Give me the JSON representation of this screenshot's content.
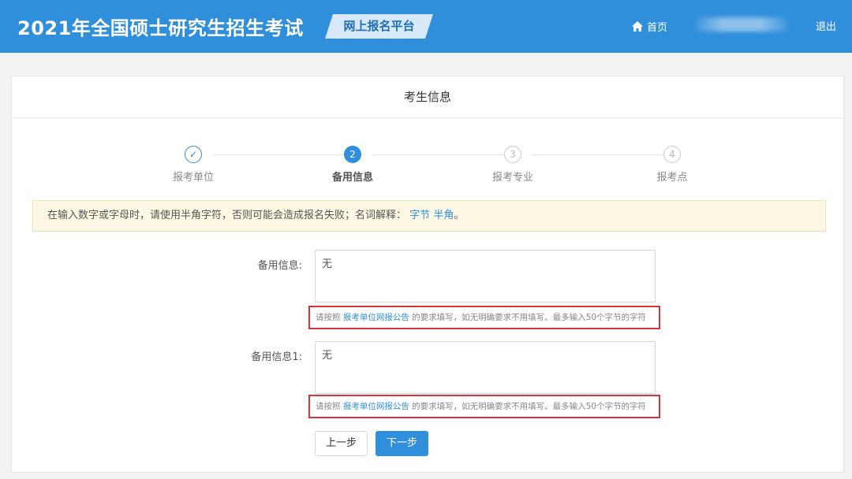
{
  "header": {
    "title": "2021年全国硕士研究生招生考试",
    "platform_badge": "网上报名平台",
    "home_label": "首页",
    "logout_label": "退出"
  },
  "card": {
    "title": "考生信息"
  },
  "steps": [
    {
      "number": "✓",
      "label": "报考单位",
      "state": "done"
    },
    {
      "number": "2",
      "label": "备用信息",
      "state": "active"
    },
    {
      "number": "3",
      "label": "报考专业",
      "state": "todo"
    },
    {
      "number": "4",
      "label": "报考点",
      "state": "todo"
    }
  ],
  "notice": {
    "text": "在输入数字或字母时，请使用半角字符，否则可能会造成报名失败；名词解释：",
    "link1": "字节",
    "link2": "半角",
    "end": "。"
  },
  "fields": [
    {
      "label": "备用信息:",
      "value": "无",
      "hint_prefix": "请按照 ",
      "hint_link": "报考单位网报公告",
      "hint_suffix": " 的要求填写，如无明确要求不用填写。最多输入50个字节的字符"
    },
    {
      "label": "备用信息1:",
      "value": "无",
      "hint_prefix": "请按照 ",
      "hint_link": "报考单位网报公告",
      "hint_suffix": " 的要求填写，如无明确要求不用填写。最多输入50个字节的字符"
    }
  ],
  "buttons": {
    "prev": "上一步",
    "next": "下一步"
  },
  "colors": {
    "primary": "#2f8fdb",
    "highlight_border": "#d9323f",
    "notice_bg": "#fcf8e3"
  }
}
